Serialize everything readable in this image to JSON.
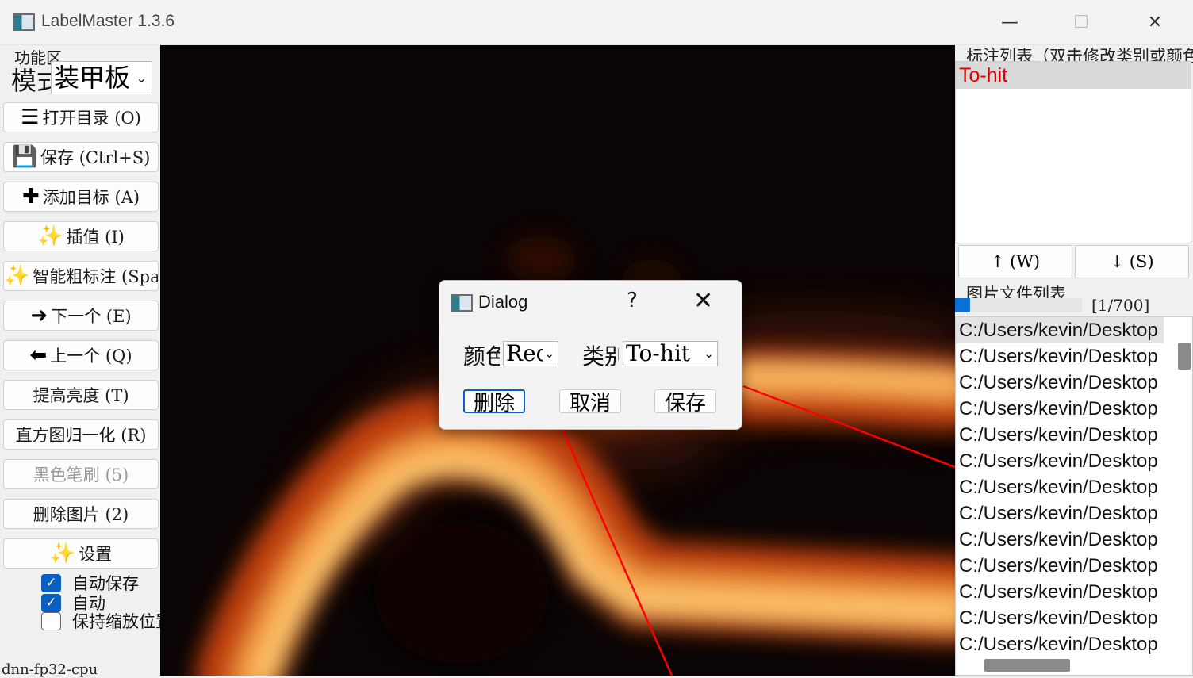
{
  "window": {
    "title": "LabelMaster 1.3.6",
    "minimize": "—",
    "maximize": "☐",
    "close": "✕"
  },
  "left": {
    "header": "功能区",
    "mode_label": "模式",
    "mode_value": "装甲板",
    "buttons": [
      {
        "label": "打开目录 (O)",
        "icon": "folder-icon",
        "glyph": "☰"
      },
      {
        "label": "保存 (Ctrl+S)",
        "icon": "save-icon",
        "glyph": "💾"
      },
      {
        "label": "添加目标 (A)",
        "icon": "plus-icon",
        "glyph": "✚"
      },
      {
        "label": "插值 (I)",
        "icon": "magic-wand-icon",
        "glyph": "✨"
      },
      {
        "label": "智能粗标注 (Space)",
        "icon": "magic-icon",
        "glyph": "✨"
      },
      {
        "label": "下一个 (E)",
        "icon": "arrow-right-icon",
        "glyph": "➜"
      },
      {
        "label": "上一个 (Q)",
        "icon": "arrow-left-icon",
        "glyph": "⬅"
      },
      {
        "label": "提高亮度 (T)",
        "icon": "",
        "glyph": ""
      },
      {
        "label": "直方图归一化 (R)",
        "icon": "",
        "glyph": ""
      },
      {
        "label": "黑色笔刷 (5)",
        "icon": "",
        "glyph": ""
      },
      {
        "label": "删除图片 (2)",
        "icon": "",
        "glyph": ""
      },
      {
        "label": "设置",
        "icon": "settings-wand-icon",
        "glyph": "✨"
      }
    ],
    "checkboxes": [
      {
        "label": "自动保存",
        "checked": true
      },
      {
        "label": "自动",
        "checked": true
      },
      {
        "label": "保持缩放位置",
        "checked": false
      }
    ],
    "model": "dnn-fp32-cpu"
  },
  "right": {
    "annotation_header": "标注列表（双击修改类别或颜色）",
    "annotations": [
      "To-hit"
    ],
    "up_button": "↑ (W)",
    "down_button": "↓ (S)",
    "files_header": "图片文件列表",
    "progress": 0.0014,
    "counter": "[1/700]",
    "files": [
      "C:/Users/kevin/Desktop",
      "C:/Users/kevin/Desktop",
      "C:/Users/kevin/Desktop",
      "C:/Users/kevin/Desktop",
      "C:/Users/kevin/Desktop",
      "C:/Users/kevin/Desktop",
      "C:/Users/kevin/Desktop",
      "C:/Users/kevin/Desktop",
      "C:/Users/kevin/Desktop",
      "C:/Users/kevin/Desktop",
      "C:/Users/kevin/Desktop",
      "C:/Users/kevin/Desktop",
      "C:/Users/kevin/Desktop"
    ]
  },
  "dialog": {
    "title": "Dialog",
    "help": "?",
    "close": "✕",
    "color_label": "颜色",
    "color_value": "Red",
    "class_label": "类别",
    "class_value": "To-hit",
    "delete_button": "删除",
    "cancel_button": "取消",
    "save_button": "保存"
  },
  "colors": {
    "accent": "#0a5fc1",
    "annotation_text": "#e00000",
    "annotation_line": "#ff0000"
  }
}
